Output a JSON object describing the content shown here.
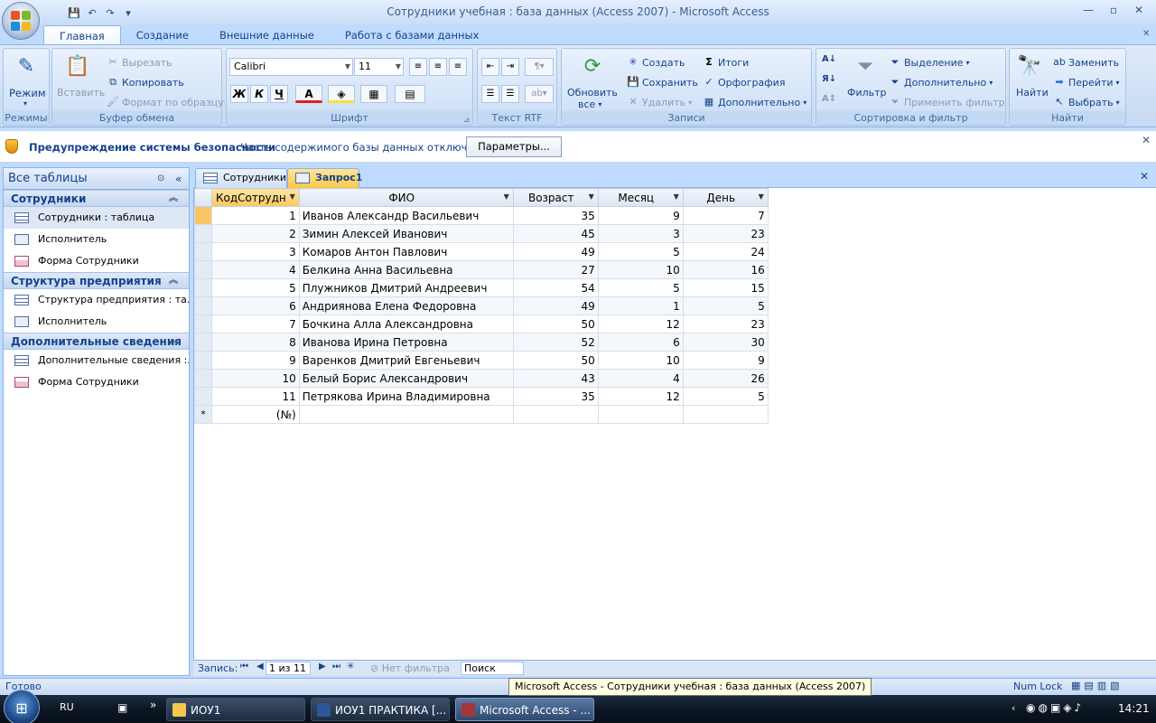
{
  "window": {
    "title": "Сотрудники учебная : база данных (Access 2007) - Microsoft Access"
  },
  "ribbon": {
    "tabs": [
      "Главная",
      "Создание",
      "Внешние данные",
      "Работа с базами данных"
    ],
    "groups": {
      "views": {
        "label": "Режимы",
        "view_button": "Режим"
      },
      "clipboard": {
        "label": "Буфер обмена",
        "paste": "Вставить",
        "cut": "Вырезать",
        "copy": "Копировать",
        "format_painter": "Формат по образцу"
      },
      "font": {
        "label": "Шрифт",
        "font_name": "Calibri",
        "font_size": "11",
        "bold": "Ж",
        "italic": "К",
        "underline": "Ч",
        "font_color_glyph": "А"
      },
      "rtf": {
        "label": "Текст RTF"
      },
      "records": {
        "label": "Записи",
        "refresh": "Обновить",
        "refresh2": "все",
        "new": "Создать",
        "save": "Сохранить",
        "delete": "Удалить",
        "totals": "Итоги",
        "spelling": "Орфография",
        "more": "Дополнительно"
      },
      "sort_filter": {
        "label": "Сортировка и фильтр",
        "filter": "Фильтр",
        "selection": "Выделение",
        "advanced": "Дополнительно",
        "toggle_filter": "Применить фильтр"
      },
      "find": {
        "label": "Найти",
        "find": "Найти",
        "replace": "Заменить",
        "goto": "Перейти",
        "select": "Выбрать"
      }
    }
  },
  "message_bar": {
    "title": "Предупреждение системы безопасности",
    "text": "Часть содержимого базы данных отключено",
    "button": "Параметры..."
  },
  "nav_pane": {
    "header": "Все таблицы",
    "groups": [
      {
        "name": "Сотрудники",
        "items": [
          "Сотрудники : таблица",
          "Исполнитель",
          "Форма Сотрудники"
        ]
      },
      {
        "name": "Структура предприятия",
        "items": [
          "Структура предприятия : та...",
          "Исполнитель"
        ]
      },
      {
        "name": "Дополнительные сведения",
        "items": [
          "Дополнительные сведения :...",
          "Форма Сотрудники"
        ]
      }
    ]
  },
  "doc_tabs": [
    "Сотрудники",
    "Запрос1"
  ],
  "datasheet": {
    "columns": [
      "КодСотрудн",
      "ФИО",
      "Возраст",
      "Месяц",
      "День"
    ],
    "rows": [
      [
        "1",
        "Иванов Александр Васильевич",
        "35",
        "9",
        "7"
      ],
      [
        "2",
        "Зимин Алексей Иванович",
        "45",
        "3",
        "23"
      ],
      [
        "3",
        "Комаров Антон Павлович",
        "49",
        "5",
        "24"
      ],
      [
        "4",
        "Белкина Анна Васильевна",
        "27",
        "10",
        "16"
      ],
      [
        "5",
        "Плужников Дмитрий Андреевич",
        "54",
        "5",
        "15"
      ],
      [
        "6",
        "Андриянова Елена Федоровна",
        "49",
        "1",
        "5"
      ],
      [
        "7",
        "Бочкина Алла Александровна",
        "50",
        "12",
        "23"
      ],
      [
        "8",
        "Иванова Ирина Петровна",
        "52",
        "6",
        "30"
      ],
      [
        "9",
        "Варенков Дмитрий Евгеньевич",
        "50",
        "10",
        "9"
      ],
      [
        "10",
        "Белый Борис Александрович",
        "43",
        "4",
        "26"
      ],
      [
        "11",
        "Петрякова Ирина Владимировна",
        "35",
        "12",
        "5"
      ]
    ],
    "new_row_marker": "*",
    "new_row_placeholder": "(№)"
  },
  "record_nav": {
    "label": "Запись:",
    "position": "1 из 11",
    "filter": "Нет фильтра",
    "search": "Поиск"
  },
  "status_bar": {
    "left": "Готово",
    "num_lock": "Num Lock",
    "tooltip": "Microsoft Access - Сотрудники учебная : база данных (Access 2007)"
  },
  "taskbar": {
    "lang": "RU",
    "buttons": [
      "ИОУ1",
      "ИОУ1 ПРАКТИКА [...",
      "Microsoft Access - ..."
    ],
    "time": "14:21"
  }
}
